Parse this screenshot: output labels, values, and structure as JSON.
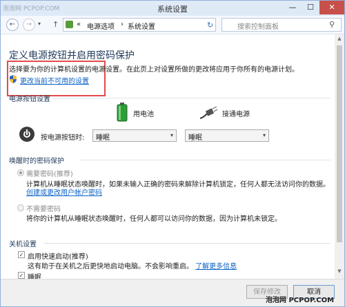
{
  "window": {
    "title": "系统设置",
    "watermark_top": "泡泡网 PCPOP.COM",
    "min_glyph": "—",
    "max_glyph": "☐",
    "close_glyph": "✕"
  },
  "nav": {
    "back": "←",
    "forward": "→",
    "dropdown": "▾",
    "up": "↑",
    "breadcrumb": [
      {
        "label": "«"
      },
      {
        "label": "电源选项"
      },
      {
        "label": "›"
      },
      {
        "label": "系统设置"
      }
    ],
    "address_dropdown": "▾",
    "refresh": "↻",
    "search_placeholder": "搜索控制面板",
    "search_icon": "⚲"
  },
  "main": {
    "title": "定义电源按钮并启用密码保护",
    "description": "选择要为你的计算机设置的电源设置。在此页上对设置所做的更改将应用于你所有的电源计划。",
    "change_link": "更改当前不可用的设置",
    "power_button_section": "电源按钮设置",
    "battery_label": "用电池",
    "ac_label": "接通电源",
    "press_label": "按电源按钮时:",
    "battery_value": "睡眠",
    "ac_value": "睡眠",
    "select_arrow": "▾",
    "password_section": "唤醒时的密码保护",
    "require_password": "需要密码(推荐)",
    "require_password_desc": "计算机从睡眠状态唤醒时，如果未输入正确的密码来解除计算机锁定，任何人都无法访问你的数据。",
    "account_link": "创建或更改用户帐户密码",
    "no_password": "不需要密码",
    "no_password_desc": "将你的计算机从睡眠状态唤醒时，任何人都可以访问你的数据，因为计算机未锁定。",
    "shutdown_section": "关机设置",
    "fast_startup": "启用快速启动(推荐)",
    "fast_startup_desc": "这有助于在关机之后更快地启动电脑。不会影响重启。",
    "learn_more": "了解更多信息",
    "sleep_label": "睡眠",
    "check_glyph": "✓"
  },
  "footer": {
    "save": "保存修改",
    "cancel": "取消",
    "watermark": "泡泡网 PCPOP.COM"
  },
  "colors": {
    "highlight_box": "#e24a4a",
    "link": "#0b63c7",
    "heading": "#1e395b",
    "close_button": "#c7504a"
  }
}
